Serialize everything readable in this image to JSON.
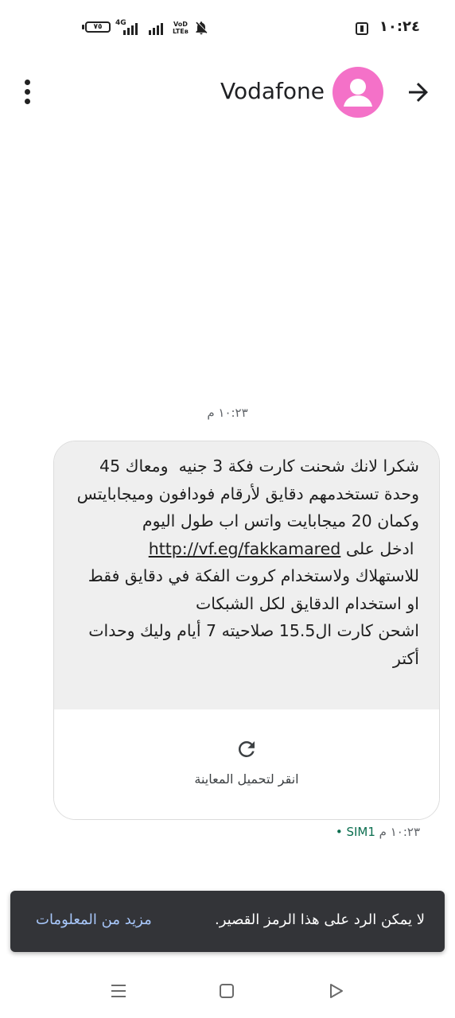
{
  "status_bar": {
    "battery_level": "٧٥",
    "network_type": "4G",
    "volte_label_top": "VoD",
    "volte_label_bottom": "LTEʙ",
    "time": "١٠:٢٤"
  },
  "header": {
    "contact_name": "Vodafone",
    "avatar_color": "#f471c8",
    "back_icon": "arrow-forward-icon",
    "menu_icon": "more-vert-icon"
  },
  "conversation": {
    "date_label": "١٠:٢٣ م",
    "message": {
      "text_before_link": "شكرا لانك شحنت كارت فكة 3 جنيه  ومعاك 45 وحدة تستخدمهم دقايق لأرقام فودافون وميجابايتس وكمان 20 ميجابايت واتس اب طول اليوم\n ادخل على ",
      "link": "http://vf.eg/fakkamared",
      "text_after_link": "\nللاستهلاك ولاستخدام كروت الفكة في دقايق فقط او استخدام الدقايق لكل الشبكات\nاشحن كارت ال15.5 صلاحيته 7 أيام وليك وحدات أكتر",
      "preview_label": "انقر لتحميل المعاينة",
      "preview_icon": "refresh-icon",
      "time": "١٠:٢٣ م",
      "sim": "SIM1 •"
    }
  },
  "snackbar": {
    "message": "لا يمكن الرد على هذا الرمز القصير.",
    "action": "مزيد من المعلومات"
  },
  "nav": {
    "recents_icon": "recents-icon",
    "home_icon": "home-icon",
    "back_icon": "back-triangle-icon"
  }
}
